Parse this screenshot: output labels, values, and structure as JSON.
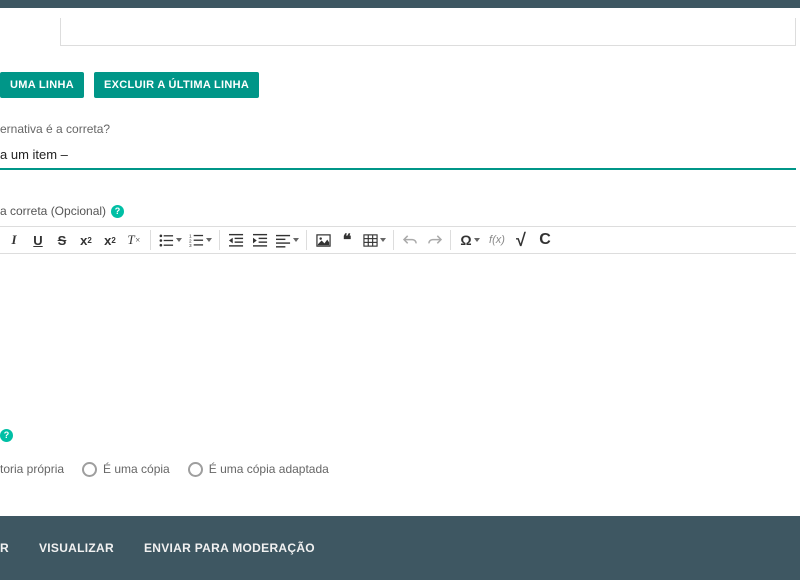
{
  "buttons": {
    "add_line": "UMA LINHA",
    "remove_last_line": "EXCLUIR A ÚLTIMA LINHA"
  },
  "correct_alt_label": "ernativa é a correta?",
  "select_placeholder": "a um item –",
  "correct_answer_label": "a correta (Opcional)",
  "help_icon": "?",
  "toolbar": {
    "italic": "I",
    "underline": "U",
    "strike": "S",
    "subscript": "x",
    "superscript": "x",
    "subscript_sub": "2",
    "superscript_sup": "2",
    "clear_format": "T",
    "quote": "❝",
    "omega": "Ω",
    "formula": "f(x)",
    "sqrt": "√",
    "custom_c": "C"
  },
  "authorship": {
    "own": "toria própria",
    "copy": "É uma cópia",
    "adapted_copy": "É uma cópia adaptada"
  },
  "footer": {
    "save_partial": "R",
    "preview": "VISUALIZAR",
    "send_moderation": "ENVIAR PARA MODERAÇÃO"
  }
}
